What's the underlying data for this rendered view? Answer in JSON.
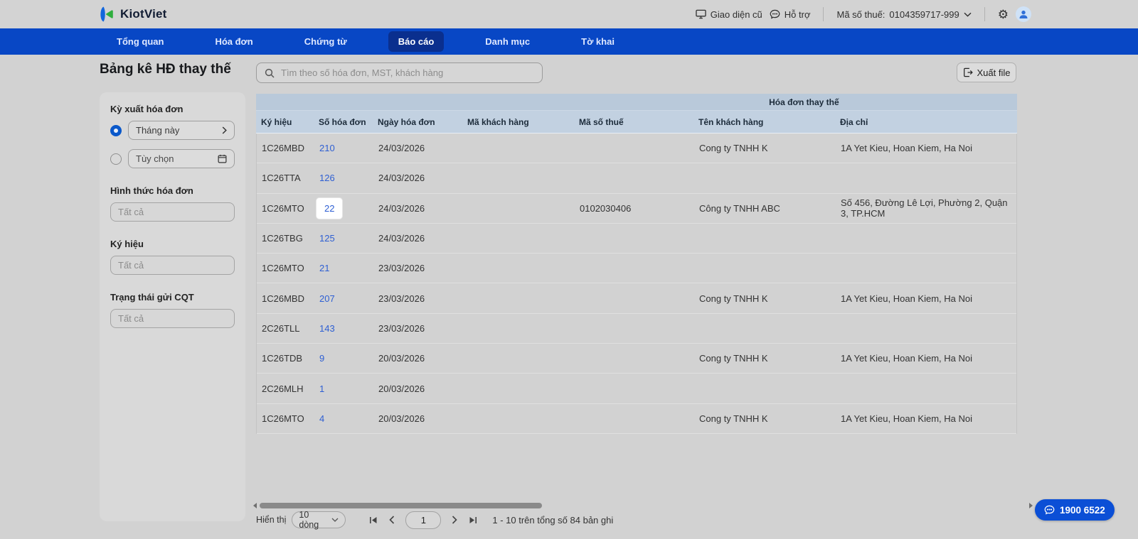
{
  "topbar": {
    "brand": "KiotViet",
    "old_ui_label": "Giao diện cũ",
    "help_label": "Hỗ trợ",
    "tax_label": "Mã số thuế:",
    "tax_value": "0104359717-999"
  },
  "nav": {
    "items": [
      {
        "label": "Tổng quan",
        "active": false
      },
      {
        "label": "Hóa đơn",
        "active": false
      },
      {
        "label": "Chứng từ",
        "active": false
      },
      {
        "label": "Báo cáo",
        "active": true
      },
      {
        "label": "Danh mục",
        "active": false
      },
      {
        "label": "Tờ khai",
        "active": false
      }
    ]
  },
  "page": {
    "title": "Bảng kê HĐ thay thế"
  },
  "filters": {
    "period": {
      "label": "Kỳ xuất hóa đơn",
      "option_selected": "Tháng này",
      "option_custom": "Tùy chọn"
    },
    "invoice_type": {
      "label": "Hình thức hóa đơn",
      "value": "Tất cả"
    },
    "symbol": {
      "label": "Ký hiệu",
      "value": "Tất cả"
    },
    "cqt_status": {
      "label": "Trạng thái gửi CQT",
      "value": "Tất cả"
    }
  },
  "toolbar": {
    "search_placeholder": "Tìm theo số hóa đơn, MST, khách hàng",
    "export_label": "Xuất file"
  },
  "table": {
    "group_header": "Hóa đơn thay thế",
    "columns": [
      "Ký hiệu",
      "Số hóa đơn",
      "Ngày hóa đơn",
      "Mã khách hàng",
      "Mã số thuế",
      "Tên khách hàng",
      "Địa chỉ"
    ],
    "rows": [
      {
        "ky_hieu": "1C26MBD",
        "so_hd": "210",
        "ngay": "24/03/2026",
        "ma_kh": "",
        "mst": "",
        "ten_kh": "Cong ty TNHH K",
        "dia_chi": "1A Yet Kieu, Hoan Kiem, Ha Noi",
        "highlight": false
      },
      {
        "ky_hieu": "1C26TTA",
        "so_hd": "126",
        "ngay": "24/03/2026",
        "ma_kh": "",
        "mst": "",
        "ten_kh": "",
        "dia_chi": "",
        "highlight": false
      },
      {
        "ky_hieu": "1C26MTO",
        "so_hd": "22",
        "ngay": "24/03/2026",
        "ma_kh": "",
        "mst": "0102030406",
        "ten_kh": "Công ty TNHH ABC",
        "dia_chi": "Số 456, Đường Lê Lợi, Phường 2, Quận 3, TP.HCM",
        "highlight": true
      },
      {
        "ky_hieu": "1C26TBG",
        "so_hd": "125",
        "ngay": "24/03/2026",
        "ma_kh": "",
        "mst": "",
        "ten_kh": "",
        "dia_chi": "",
        "highlight": false
      },
      {
        "ky_hieu": "1C26MTO",
        "so_hd": "21",
        "ngay": "23/03/2026",
        "ma_kh": "",
        "mst": "",
        "ten_kh": "",
        "dia_chi": "",
        "highlight": false
      },
      {
        "ky_hieu": "1C26MBD",
        "so_hd": "207",
        "ngay": "23/03/2026",
        "ma_kh": "",
        "mst": "",
        "ten_kh": "Cong ty TNHH K",
        "dia_chi": "1A Yet Kieu, Hoan Kiem, Ha Noi",
        "highlight": false
      },
      {
        "ky_hieu": "2C26TLL",
        "so_hd": "143",
        "ngay": "23/03/2026",
        "ma_kh": "",
        "mst": "",
        "ten_kh": "",
        "dia_chi": "",
        "highlight": false
      },
      {
        "ky_hieu": "1C26TDB",
        "so_hd": "9",
        "ngay": "20/03/2026",
        "ma_kh": "",
        "mst": "",
        "ten_kh": "Cong ty TNHH K",
        "dia_chi": "1A Yet Kieu, Hoan Kiem, Ha Noi",
        "highlight": false
      },
      {
        "ky_hieu": "2C26MLH",
        "so_hd": "1",
        "ngay": "20/03/2026",
        "ma_kh": "",
        "mst": "",
        "ten_kh": "",
        "dia_chi": "",
        "highlight": false
      },
      {
        "ky_hieu": "1C26MTO",
        "so_hd": "4",
        "ngay": "20/03/2026",
        "ma_kh": "",
        "mst": "",
        "ten_kh": "Cong ty TNHH K",
        "dia_chi": "1A Yet Kieu, Hoan Kiem, Ha Noi",
        "highlight": false
      }
    ]
  },
  "pagination": {
    "show_label": "Hiển thị",
    "page_size": "10 dòng",
    "current_page": "1",
    "summary": "1 - 10 trên tổng số 84 bản ghi"
  },
  "support": {
    "phone": "1900 6522"
  },
  "colors": {
    "nav_blue": "#0847c5",
    "nav_active": "#0a2f8e",
    "link_blue": "#2e5fd3",
    "table_header": "#c2d1e1",
    "table_group_header": "#b9c9da",
    "support_pill": "#0b4fd6",
    "brand_green": "#2fae3e",
    "brand_blue": "#1266dd",
    "page_bg": "#d2d2d2"
  }
}
